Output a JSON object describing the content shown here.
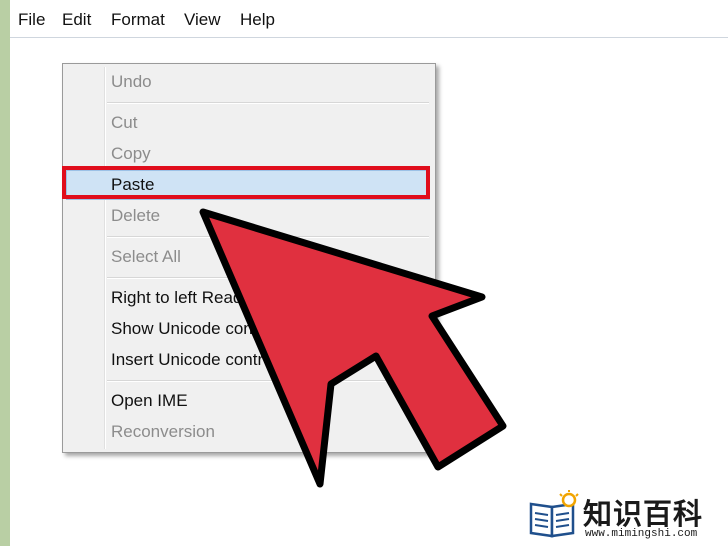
{
  "menubar": {
    "items": [
      {
        "label": "File"
      },
      {
        "label": "Edit"
      },
      {
        "label": "Format"
      },
      {
        "label": "View"
      },
      {
        "label": "Help"
      }
    ]
  },
  "context_menu": {
    "items": [
      {
        "label": "Undo",
        "enabled": false
      },
      {
        "label": "Cut",
        "enabled": false
      },
      {
        "label": "Copy",
        "enabled": false
      },
      {
        "label": "Paste",
        "enabled": true,
        "highlighted": true
      },
      {
        "label": "Delete",
        "enabled": false
      },
      {
        "label": "Select All",
        "enabled": false
      },
      {
        "label": "Right to left Reading order",
        "enabled": true
      },
      {
        "label": "Show Unicode control characters",
        "enabled": true
      },
      {
        "label": "Insert Unicode control character",
        "enabled": true,
        "has_submenu": true
      },
      {
        "label": "Open IME",
        "enabled": true
      },
      {
        "label": "Reconversion",
        "enabled": false
      }
    ]
  },
  "colors": {
    "highlight_box": "#e00d1c",
    "pointer_arrow_fill": "#e0303f",
    "pointer_arrow_outline": "#000000",
    "background": "#b9cfa4"
  },
  "watermark": {
    "title": "知识百科",
    "url": "www.mimingshi.com",
    "icon": "book-lightbulb-icon"
  }
}
